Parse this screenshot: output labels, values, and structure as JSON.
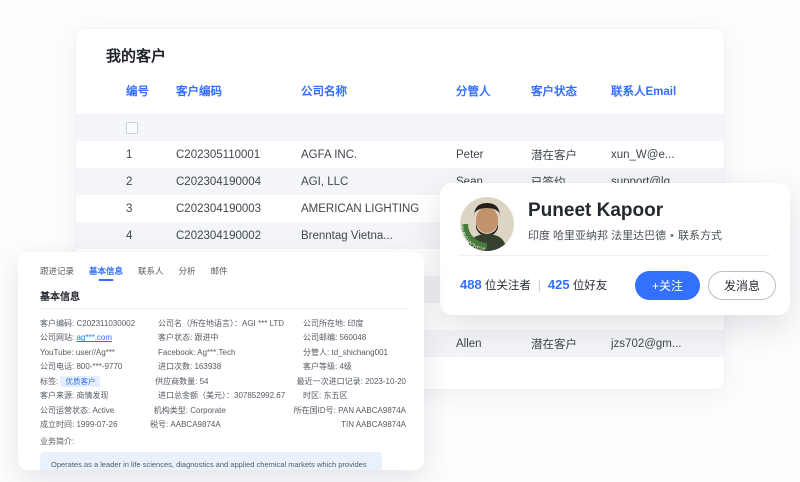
{
  "window": {
    "title": "我的客户"
  },
  "colors": {
    "accent": "#3370ff",
    "zebra_band": "#f4f5f8",
    "tag_bg": "#e4eeff",
    "open_to_work_green": "#457b3b",
    "biz_box_bg": "#e9f1fc"
  },
  "table": {
    "columns": [
      "编号",
      "客户编码",
      "公司名称",
      "分管人",
      "客户状态",
      "联系人Email"
    ],
    "rows": [
      {
        "no": "1",
        "code": "C202305110001",
        "company": "AGFA INC.",
        "manager": "Peter",
        "status": "潜在客户",
        "email": "xun_W@e..."
      },
      {
        "no": "2",
        "code": "C202304190004",
        "company": "AGI, LLC",
        "manager": "Sean",
        "status": "已签约",
        "email": "support@lg..."
      },
      {
        "no": "3",
        "code": "C202304190003",
        "company": "AMERICAN LIGHTING",
        "manager": "",
        "status": "",
        "email": ""
      },
      {
        "no": "4",
        "code": "C202304190002",
        "company": "Brenntag Vietna...",
        "manager": "",
        "status": "",
        "email": ""
      },
      {
        "no": "",
        "code": "",
        "company": "",
        "manager": "",
        "status": "",
        "email": ""
      },
      {
        "no": "",
        "code": "",
        "company": "",
        "manager": "",
        "status": "",
        "email": ""
      },
      {
        "no": "",
        "code": "",
        "company": "",
        "manager": "",
        "status": "",
        "email": ""
      },
      {
        "no": "",
        "code": "",
        "company": "",
        "manager": "Allen",
        "status": "潜在客户",
        "email": "jzs702@gm..."
      }
    ]
  },
  "profile": {
    "name": "Puneet Kapoor",
    "location": "印度 哈里亚纳邦 法里达巴德",
    "dot": "•",
    "contact_label": "联系方式",
    "followers_count": "488",
    "followers_label": "位关注者",
    "separator": "|",
    "friends_count": "425",
    "friends_label": "位好友",
    "follow_button": "+关注",
    "message_button": "发消息",
    "avatar_badge": "#OPENTOWORK"
  },
  "detail": {
    "tabs": [
      "跟进记录",
      "基本信息",
      "联系人",
      "分析",
      "邮件"
    ],
    "active_tab": "基本信息",
    "section_title": "基本信息",
    "rows": [
      {
        "c1l": "客户编码:",
        "c1v": "C202311030002",
        "c2l": "公司名（所在地语言）：",
        "c2v": "AGI *** LTD",
        "c3l": "公司所在地:",
        "c3v": "印度"
      },
      {
        "c1l": "公司网站:",
        "c1v": "ag***.com",
        "c2l": "客户状态:",
        "c2v": "跟进中",
        "c3l": "公司邮编:",
        "c3v": "560048"
      },
      {
        "c1l": "YouTube:",
        "c1v": "user//Ag***",
        "c2l": "Facebook:",
        "c2v": "Ag***.Tech",
        "c3l": "分管人:",
        "c3v": "td_shichang001"
      },
      {
        "c1l": "公司电话:",
        "c1v": "800-***-9770",
        "c2l": "进口次数:",
        "c2v": "163938",
        "c3l": "客户等级:",
        "c3v": "4级"
      },
      {
        "c1l": "标签:",
        "c1v": "优质客户",
        "c2l": "供应商数量:",
        "c2v": "54",
        "c3l": "最近一次进口记录:",
        "c3v": "2023-10-20"
      },
      {
        "c1l": "客户来源:",
        "c1v": "商情发现",
        "c2l": "进口总金额（美元）：",
        "c2v": "307852992.67",
        "c3l": "时区:",
        "c3v": "东五区"
      },
      {
        "c1l": "公司运营状态:",
        "c1v": "Active",
        "c2l": "机构类型:",
        "c2v": "Corporate",
        "c3l": "所在国ID号:",
        "c3v": "PAN AABCA9874A"
      },
      {
        "c1l": "成立时间:",
        "c1v": "1999-07-26",
        "c2l": "税号:",
        "c2v": "AABCA9874A",
        "c3l": "",
        "c3v": "TIN AABCA9874A"
      }
    ],
    "biz_label": "业务简介:",
    "biz_text": "Operates as a leader in life sciences, diagnostics and applied chemical markets which provides laboratories worldwide with instruments, services, consumables, applications and expertise"
  }
}
